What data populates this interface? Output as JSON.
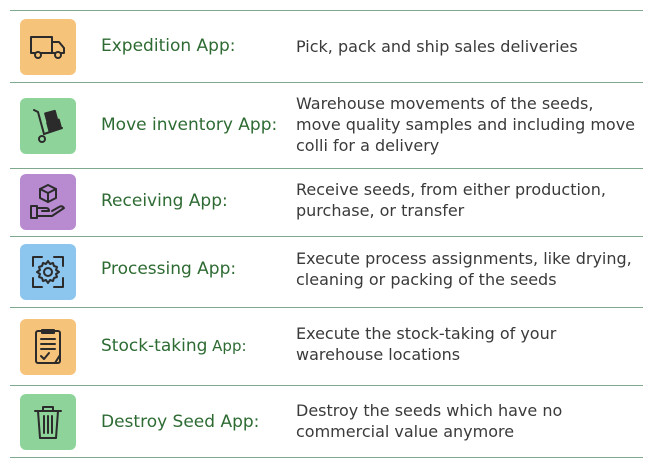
{
  "colors": {
    "border": "#7fa98f",
    "name_text": "#2e6b33",
    "desc_text": "#3a3a3a"
  },
  "apps": [
    {
      "name": "Expedition App:",
      "description": "Pick, pack and ship sales deliveries",
      "icon": "truck-icon",
      "icon_bg": "#f6c37a"
    },
    {
      "name": "Move inventory App:",
      "description": "Warehouse movements of the seeds, move quality samples and including move colli for a delivery",
      "icon": "hand-truck-icon",
      "icon_bg": "#8ed39a"
    },
    {
      "name": "Receiving App:",
      "description": "Receive seeds, from either production, purchase, or transfer",
      "icon": "hand-receiving-box-icon",
      "icon_bg": "#b88bd0"
    },
    {
      "name": "Processing App:",
      "description": "Execute process assignments, like drying, cleaning or packing of the seeds",
      "icon": "gear-cycle-icon",
      "icon_bg": "#8cc6ee"
    },
    {
      "name_main": "Stock-taking",
      "name_suffix": " App:",
      "description": "Execute the stock-taking of your warehouse locations",
      "icon": "clipboard-check-icon",
      "icon_bg": "#f6c37a"
    },
    {
      "name": "Destroy Seed App:",
      "description": "Destroy the seeds which have no commercial value anymore",
      "icon": "trash-bin-icon",
      "icon_bg": "#8ed39a"
    }
  ]
}
